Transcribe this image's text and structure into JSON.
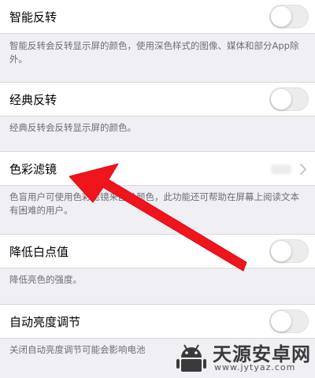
{
  "settings": {
    "smart_invert": {
      "label": "智能反转",
      "description": "智能反转会反转显示屏的颜色，使用深色样式的图像、媒体和部分App除外。",
      "toggle_on": false
    },
    "classic_invert": {
      "label": "经典反转",
      "description": "经典反转会反转显示屏的颜色。",
      "toggle_on": false
    },
    "color_filters": {
      "label": "色彩滤镜",
      "description": "色盲用户可使用色彩滤镜来区分颜色，此功能还可帮助在屏幕上阅读文本有困难的用户。"
    },
    "reduce_white_point": {
      "label": "降低白点值",
      "description": "降低亮色的强度。",
      "toggle_on": false
    },
    "auto_brightness": {
      "label": "自动亮度调节",
      "description": "关闭自动亮度调节可能会影响电池",
      "toggle_on": false
    }
  },
  "icons": {
    "chevron": "chevron-right-icon",
    "arrow": "red-arrow-annotation"
  },
  "watermark": {
    "title": "天源安卓网",
    "url": "www.jytyaz.com"
  },
  "colors": {
    "background": "#efeff4",
    "cell": "#ffffff",
    "description_text": "#6d6d72",
    "arrow": "#f0141c",
    "toggle_off": "#ececec"
  }
}
